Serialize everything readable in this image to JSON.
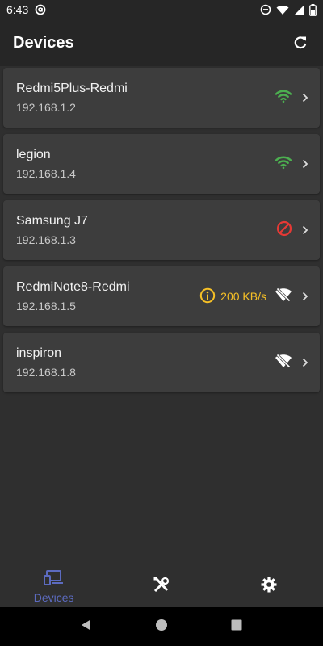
{
  "status_bar": {
    "time": "6:43",
    "icons": [
      "at-sign-icon",
      "do-not-disturb-icon",
      "wifi-icon",
      "signal-icon",
      "battery-icon"
    ]
  },
  "app_bar": {
    "title": "Devices",
    "action_icon": "refresh-icon"
  },
  "devices": [
    {
      "name": "Redmi5Plus-Redmi",
      "ip": "192.168.1.2",
      "status_icon": "wifi-icon",
      "status_color": "#4caf50"
    },
    {
      "name": "legion",
      "ip": "192.168.1.4",
      "status_icon": "wifi-icon",
      "status_color": "#4caf50"
    },
    {
      "name": "Samsung J7",
      "ip": "192.168.1.3",
      "status_icon": "blocked-icon",
      "status_color": "#e53935"
    },
    {
      "name": "RedmiNote8-Redmi",
      "ip": "192.168.1.5",
      "speed": "200 KB/s",
      "speed_icon": "info-icon",
      "speed_color": "#f6c026",
      "status_icon": "wifi-off-icon",
      "status_color": "#ffffff"
    },
    {
      "name": "inspiron",
      "ip": "192.168.1.8",
      "status_icon": "wifi-off-icon",
      "status_color": "#ffffff"
    }
  ],
  "bottom_nav": {
    "items": [
      {
        "label": "Devices",
        "icon": "devices-icon",
        "active": true
      },
      {
        "label": "",
        "icon": "tools-icon",
        "active": false
      },
      {
        "label": "",
        "icon": "settings-icon",
        "active": false
      }
    ],
    "active_color": "#5c6bc0"
  },
  "system_nav": [
    "back-icon",
    "home-icon",
    "recents-icon"
  ]
}
